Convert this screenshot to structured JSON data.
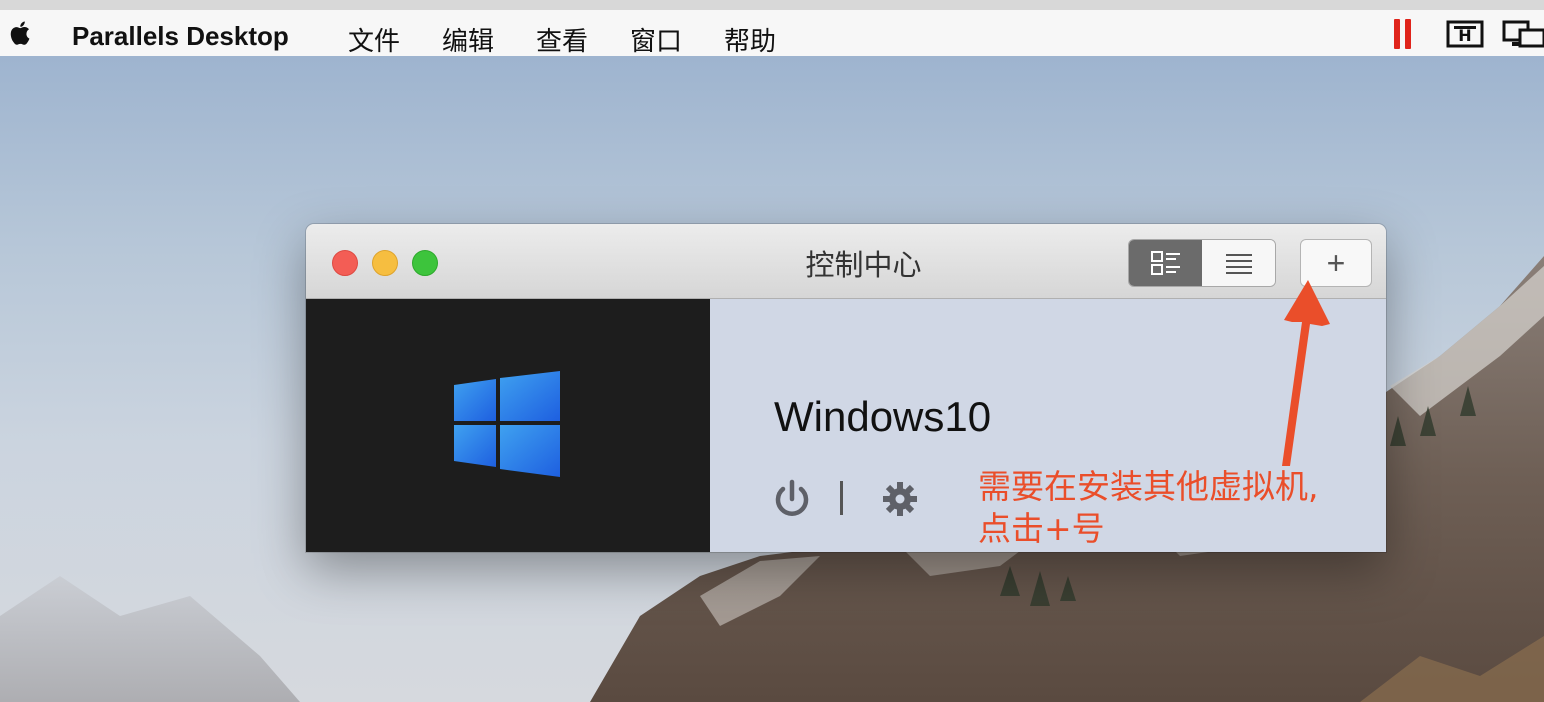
{
  "menubar": {
    "app_name": "Parallels Desktop",
    "items": [
      "文件",
      "编辑",
      "查看",
      "窗口",
      "帮助"
    ],
    "icons": [
      "apple-icon",
      "parallels-pause-icon",
      "keyboard-icon",
      "display-icon"
    ]
  },
  "window": {
    "title": "控制中心",
    "view_toggle": [
      "grid-view-icon",
      "list-view-icon"
    ],
    "add_label": "+",
    "vm": {
      "name": "Windows10",
      "os_icon": "windows-logo-icon",
      "controls": [
        "power-icon",
        "settings-gear-icon"
      ]
    }
  },
  "annotation": {
    "text_line1": "需要在安装其他虚拟机,",
    "text_line2": "点击+号",
    "color": "#ea4e2a"
  },
  "colors": {
    "pause_red": "#e0241b",
    "windows_blue": "#2f7ee8",
    "panel_bg": "#d0d7e5"
  }
}
